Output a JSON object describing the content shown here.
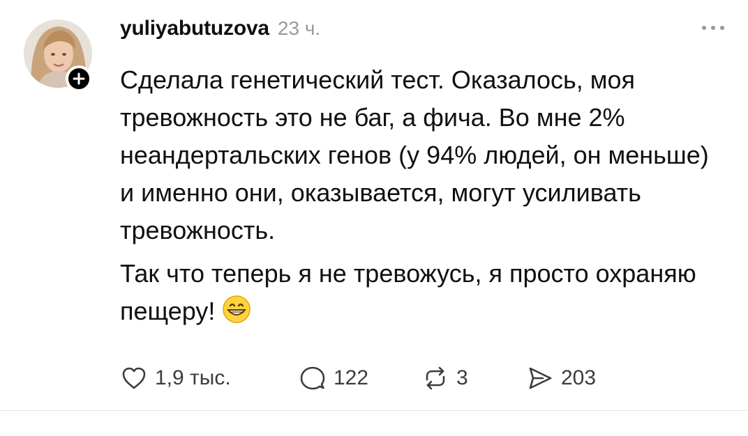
{
  "post": {
    "username": "yuliyabutuzova",
    "time": "23 ч.",
    "paragraphs": [
      "Сделала генетический тест. Оказалось, моя тревожность это не баг, а фича. Во мне 2% неандертальских генов (у 94% людей, он меньше) и именно они, оказывается, могут усиливать тревожность.",
      "Так что теперь я не тревожусь, я просто охраняю пещеру!"
    ],
    "emoji": "grinning-face-emoji"
  },
  "actions": {
    "likes": "1,9 тыс.",
    "replies": "122",
    "reposts": "3",
    "shares": "203"
  },
  "icons": {
    "avatar": "user-avatar",
    "follow": "plus-icon",
    "more": "more-dots-icon",
    "like": "heart-icon",
    "reply": "comment-bubble-icon",
    "repost": "repost-icon",
    "share": "send-icon"
  },
  "colors": {
    "text": "#101010",
    "muted": "#9a9a9a",
    "icon": "#3c3c3c",
    "badge": "#000000"
  }
}
